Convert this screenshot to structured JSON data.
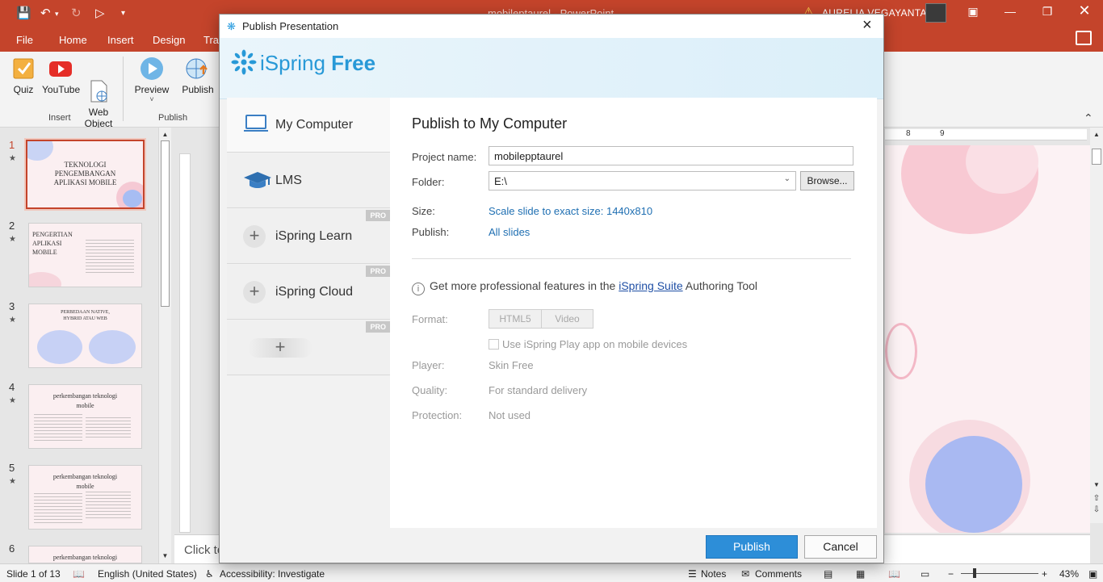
{
  "app": {
    "window_title": "mobileptaurel  -  PowerPoint",
    "user_name": "AURELIA VEGAYANTA"
  },
  "menu": [
    "File",
    "Home",
    "Insert",
    "Design",
    "Tran"
  ],
  "ribbon": {
    "buttons": [
      {
        "label": "Quiz",
        "icon": "quiz-icon"
      },
      {
        "label": "YouTube",
        "icon": "youtube-icon"
      },
      {
        "label": "Web\nObject",
        "icon": "web-object-icon"
      },
      {
        "label": "Preview",
        "icon": "preview-icon"
      },
      {
        "label": "Publish",
        "icon": "publish-icon"
      }
    ],
    "groups": [
      "Insert",
      "Publish"
    ]
  },
  "slides": [
    {
      "num": "1",
      "title": "TEKNOLOGI PENGEMBANGAN APLIKASI MOBILE"
    },
    {
      "num": "2",
      "title": "PENGERTIAN APLIKASI MOBILE"
    },
    {
      "num": "3",
      "title": "PERBEDAAN NATIVE, HYBRID ATAU WEB"
    },
    {
      "num": "4",
      "title": "perkembangan teknologi mobile"
    },
    {
      "num": "5",
      "title": "perkembangan teknologi mobile"
    },
    {
      "num": "6",
      "title": "perkembangan teknologi"
    }
  ],
  "ruler": {
    "h_ticks": [
      "8",
      "9"
    ]
  },
  "notes_placeholder": "Click to",
  "statusbar": {
    "slide_info": "Slide 1 of 13",
    "language": "English (United States)",
    "accessibility": "Accessibility: Investigate",
    "notes": "Notes",
    "comments": "Comments",
    "zoom": "43%"
  },
  "dialog": {
    "title": "Publish Presentation",
    "brand": {
      "name_light": "iSpring",
      "name_bold": "Free"
    },
    "nav": [
      {
        "label": "My Computer",
        "pro": ""
      },
      {
        "label": "LMS",
        "pro": ""
      },
      {
        "label": "iSpring Learn",
        "pro": "PRO"
      },
      {
        "label": "iSpring Cloud",
        "pro": "PRO"
      },
      {
        "label": "",
        "pro": "PRO"
      }
    ],
    "content": {
      "heading": "Publish to My Computer",
      "project_name_label": "Project name:",
      "project_name_value": "mobilepptaurel",
      "folder_label": "Folder:",
      "folder_value": "E:\\",
      "browse_label": "Browse...",
      "size_label": "Size:",
      "size_value": "Scale slide to exact size: 1440x810",
      "publish_label": "Publish:",
      "publish_value": "All slides",
      "info_prefix": "Get more professional features in the",
      "info_link": "iSpring Suite",
      "info_suffix": "Authoring Tool",
      "format_label": "Format:",
      "format_options": [
        "HTML5",
        "Video"
      ],
      "checkbox_label": "Use iSpring Play app on mobile devices",
      "player_label": "Player:",
      "player_value": "Skin Free",
      "quality_label": "Quality:",
      "quality_value": "For standard delivery",
      "protection_label": "Protection:",
      "protection_value": "Not used"
    },
    "buttons": {
      "publish": "Publish",
      "cancel": "Cancel"
    }
  },
  "colors": {
    "accent": "#c4442b",
    "brand_blue": "#2899d7",
    "primary_button": "#2d8ed8"
  }
}
